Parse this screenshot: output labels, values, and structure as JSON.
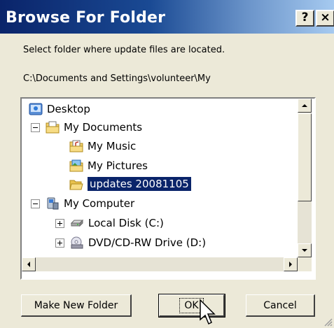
{
  "window": {
    "title": "Browse For Folder",
    "help_label": "?",
    "close_label": "×"
  },
  "description": "Select folder where update files are located.",
  "selected_path": "C:\\Documents and Settings\\volunteer\\My",
  "tree": {
    "items": [
      {
        "label": "Desktop",
        "icon": "desktop-icon"
      },
      {
        "label": "My Documents",
        "icon": "my-documents-icon",
        "expander": "minus"
      },
      {
        "label": "My Music",
        "icon": "music-folder-icon"
      },
      {
        "label": "My Pictures",
        "icon": "pictures-folder-icon"
      },
      {
        "label": "updates 20081105",
        "icon": "open-folder-icon",
        "selected": true
      },
      {
        "label": "My Computer",
        "icon": "computer-icon",
        "expander": "minus"
      },
      {
        "label": "Local Disk (C:)",
        "icon": "hard-disk-icon",
        "expander": "plus"
      },
      {
        "label": "DVD/CD-RW Drive (D:)",
        "icon": "cd-drive-icon",
        "expander": "plus"
      }
    ]
  },
  "buttons": {
    "make_new_folder": "Make New Folder",
    "ok": "OK",
    "cancel": "Cancel"
  },
  "colors": {
    "titlebar_start": "#0a246a",
    "titlebar_end": "#a6caf0",
    "selection": "#0a246a",
    "face": "#ece9d8"
  }
}
